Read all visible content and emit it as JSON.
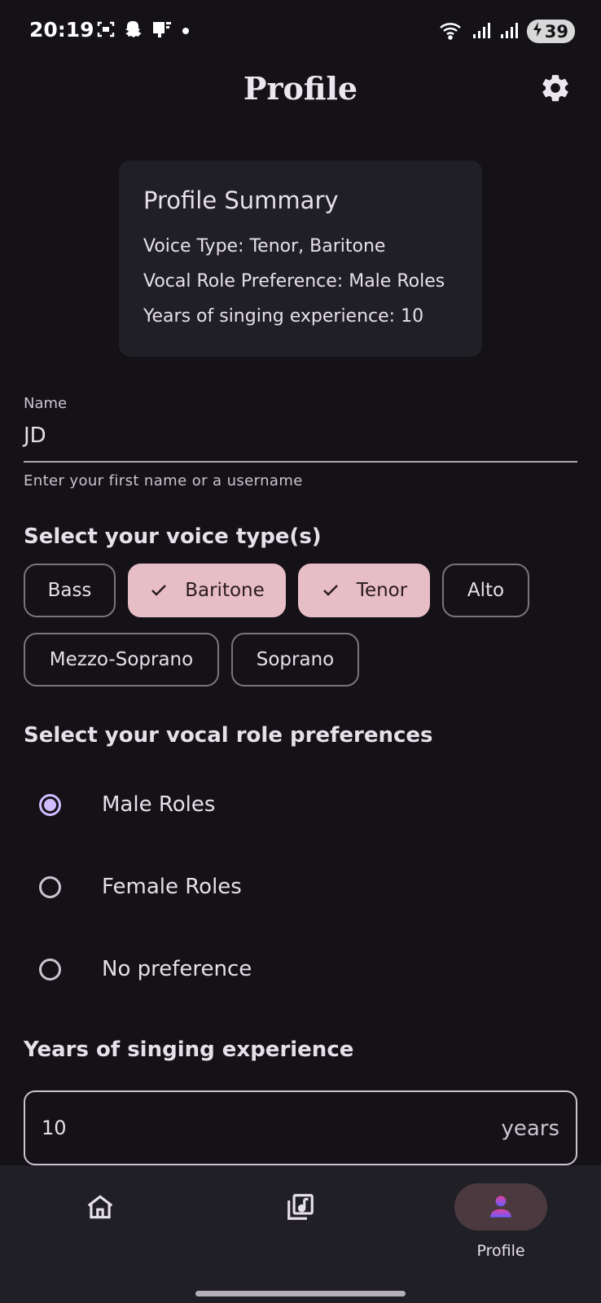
{
  "status_bar": {
    "time": "20:19",
    "battery": "39",
    "left_icons": [
      "screenshot-icon",
      "snapchat-icon",
      "cast-icon",
      "dot-icon"
    ],
    "right_icons": [
      "wifi-icon",
      "signal-icon",
      "signal-icon"
    ]
  },
  "app_bar": {
    "title": "Profile",
    "settings_icon": "gear-icon"
  },
  "summary": {
    "title": "Profile Summary",
    "voice_type": "Voice Type: Tenor, Baritone",
    "role_pref": "Vocal Role Preference: Male Roles",
    "experience": "Years of singing experience: 10"
  },
  "name_field": {
    "label": "Name",
    "value": "JD",
    "helper": "Enter your first name or a username"
  },
  "voice_section": {
    "title": "Select your voice type(s)",
    "chips": [
      {
        "label": "Bass",
        "selected": false
      },
      {
        "label": "Baritone",
        "selected": true
      },
      {
        "label": "Tenor",
        "selected": true
      },
      {
        "label": "Alto",
        "selected": false
      },
      {
        "label": "Mezzo-Soprano",
        "selected": false
      },
      {
        "label": "Soprano",
        "selected": false
      }
    ]
  },
  "role_section": {
    "title": "Select your vocal role preferences",
    "options": [
      {
        "label": "Male Roles",
        "checked": true
      },
      {
        "label": "Female Roles",
        "checked": false
      },
      {
        "label": "No preference",
        "checked": false
      }
    ]
  },
  "experience_section": {
    "title": "Years of singing experience",
    "value": "10",
    "suffix": "years"
  },
  "bottom_nav": {
    "items": [
      {
        "icon": "home-icon",
        "label": "",
        "active": false
      },
      {
        "icon": "music-library-icon",
        "label": "",
        "active": false
      },
      {
        "icon": "person-icon",
        "label": "Profile",
        "active": true
      }
    ]
  },
  "colors": {
    "background": "#141217",
    "surface": "#211f26",
    "chip_selected": "#e7bdc6",
    "radio_accent": "#d0bcff",
    "profile_icon_gradient": [
      "#e040a0",
      "#6a5cff"
    ]
  }
}
